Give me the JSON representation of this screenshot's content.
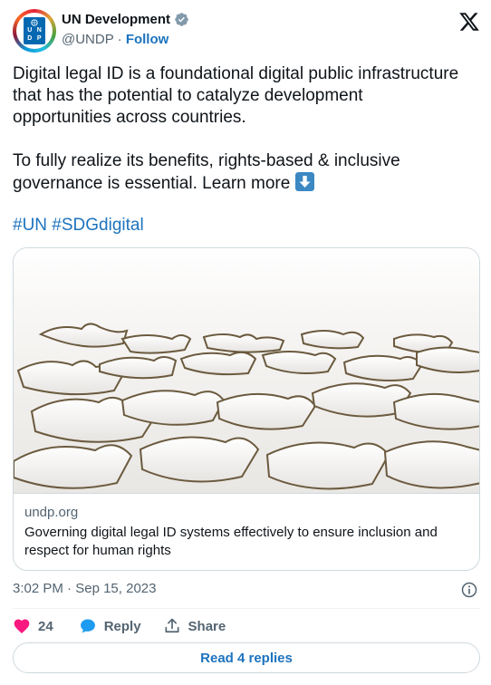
{
  "author": {
    "display_name": "UN Development",
    "handle": "@UNDP",
    "separator": "·",
    "follow_label": "Follow",
    "avatar_letters": [
      "U",
      "N",
      "D",
      "P"
    ]
  },
  "tweet": {
    "paragraph_1": "Digital legal ID is a foundational digital public infrastructure that has the potential to catalyze development opportunities across countries.",
    "paragraph_2": "To fully realize its benefits, rights-based & inclusive governance is essential. Learn more",
    "hashtag_1": "#UN",
    "hashtag_2": "#SDGdigital"
  },
  "card": {
    "domain": "undp.org",
    "title": "Governing digital legal ID systems effectively to ensure inclusion and respect for human rights",
    "image": "jigsaw-puzzle-pieces"
  },
  "meta": {
    "time": "3:02 PM",
    "date": "Sep 15, 2023",
    "separator": "·"
  },
  "actions": {
    "like_count": "24",
    "reply_label": "Reply",
    "share_label": "Share"
  },
  "read_replies_label": "Read 4 replies",
  "colors": {
    "accent": "#1d73be",
    "like": "#f91880",
    "reply": "#1d9bf0",
    "muted": "#536471",
    "border": "#cfd9de"
  },
  "icons": [
    "verified-badge-icon",
    "x-logo-icon",
    "arrow-down-emoji-icon",
    "info-icon",
    "heart-icon",
    "speech-bubble-icon",
    "share-icon"
  ]
}
